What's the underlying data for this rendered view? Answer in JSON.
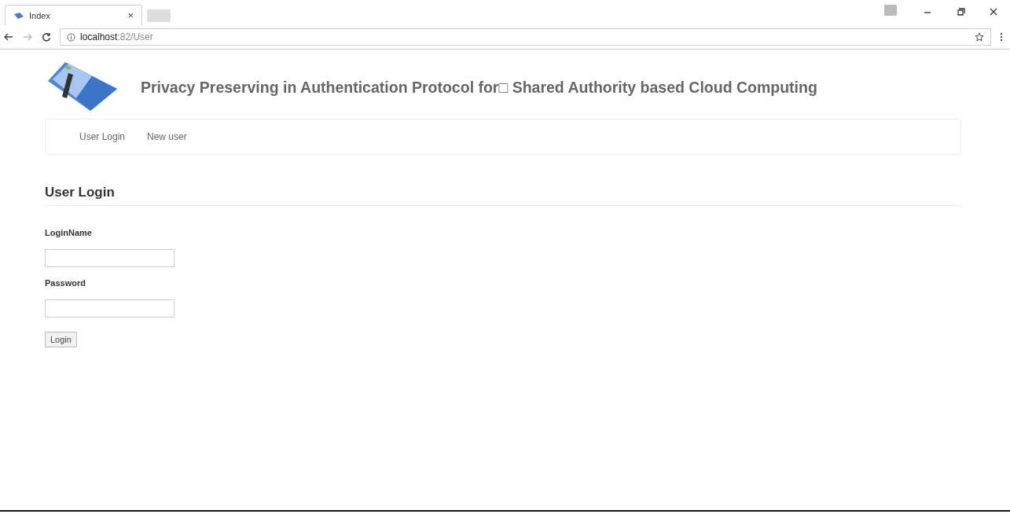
{
  "browser": {
    "tabs": [
      {
        "title": "Index",
        "close": "×",
        "selected": true
      }
    ],
    "url_host": "localhost",
    "url_path": ":82/User"
  },
  "header": {
    "title": "Privacy Preserving in Authentication Protocol for□ Shared Authority based Cloud Computing"
  },
  "nav": [
    {
      "label": "User Login"
    },
    {
      "label": "New user"
    }
  ],
  "form": {
    "heading": "User Login",
    "fields": [
      {
        "label": "LoginName"
      },
      {
        "label": "Password"
      }
    ],
    "button": "Login"
  }
}
